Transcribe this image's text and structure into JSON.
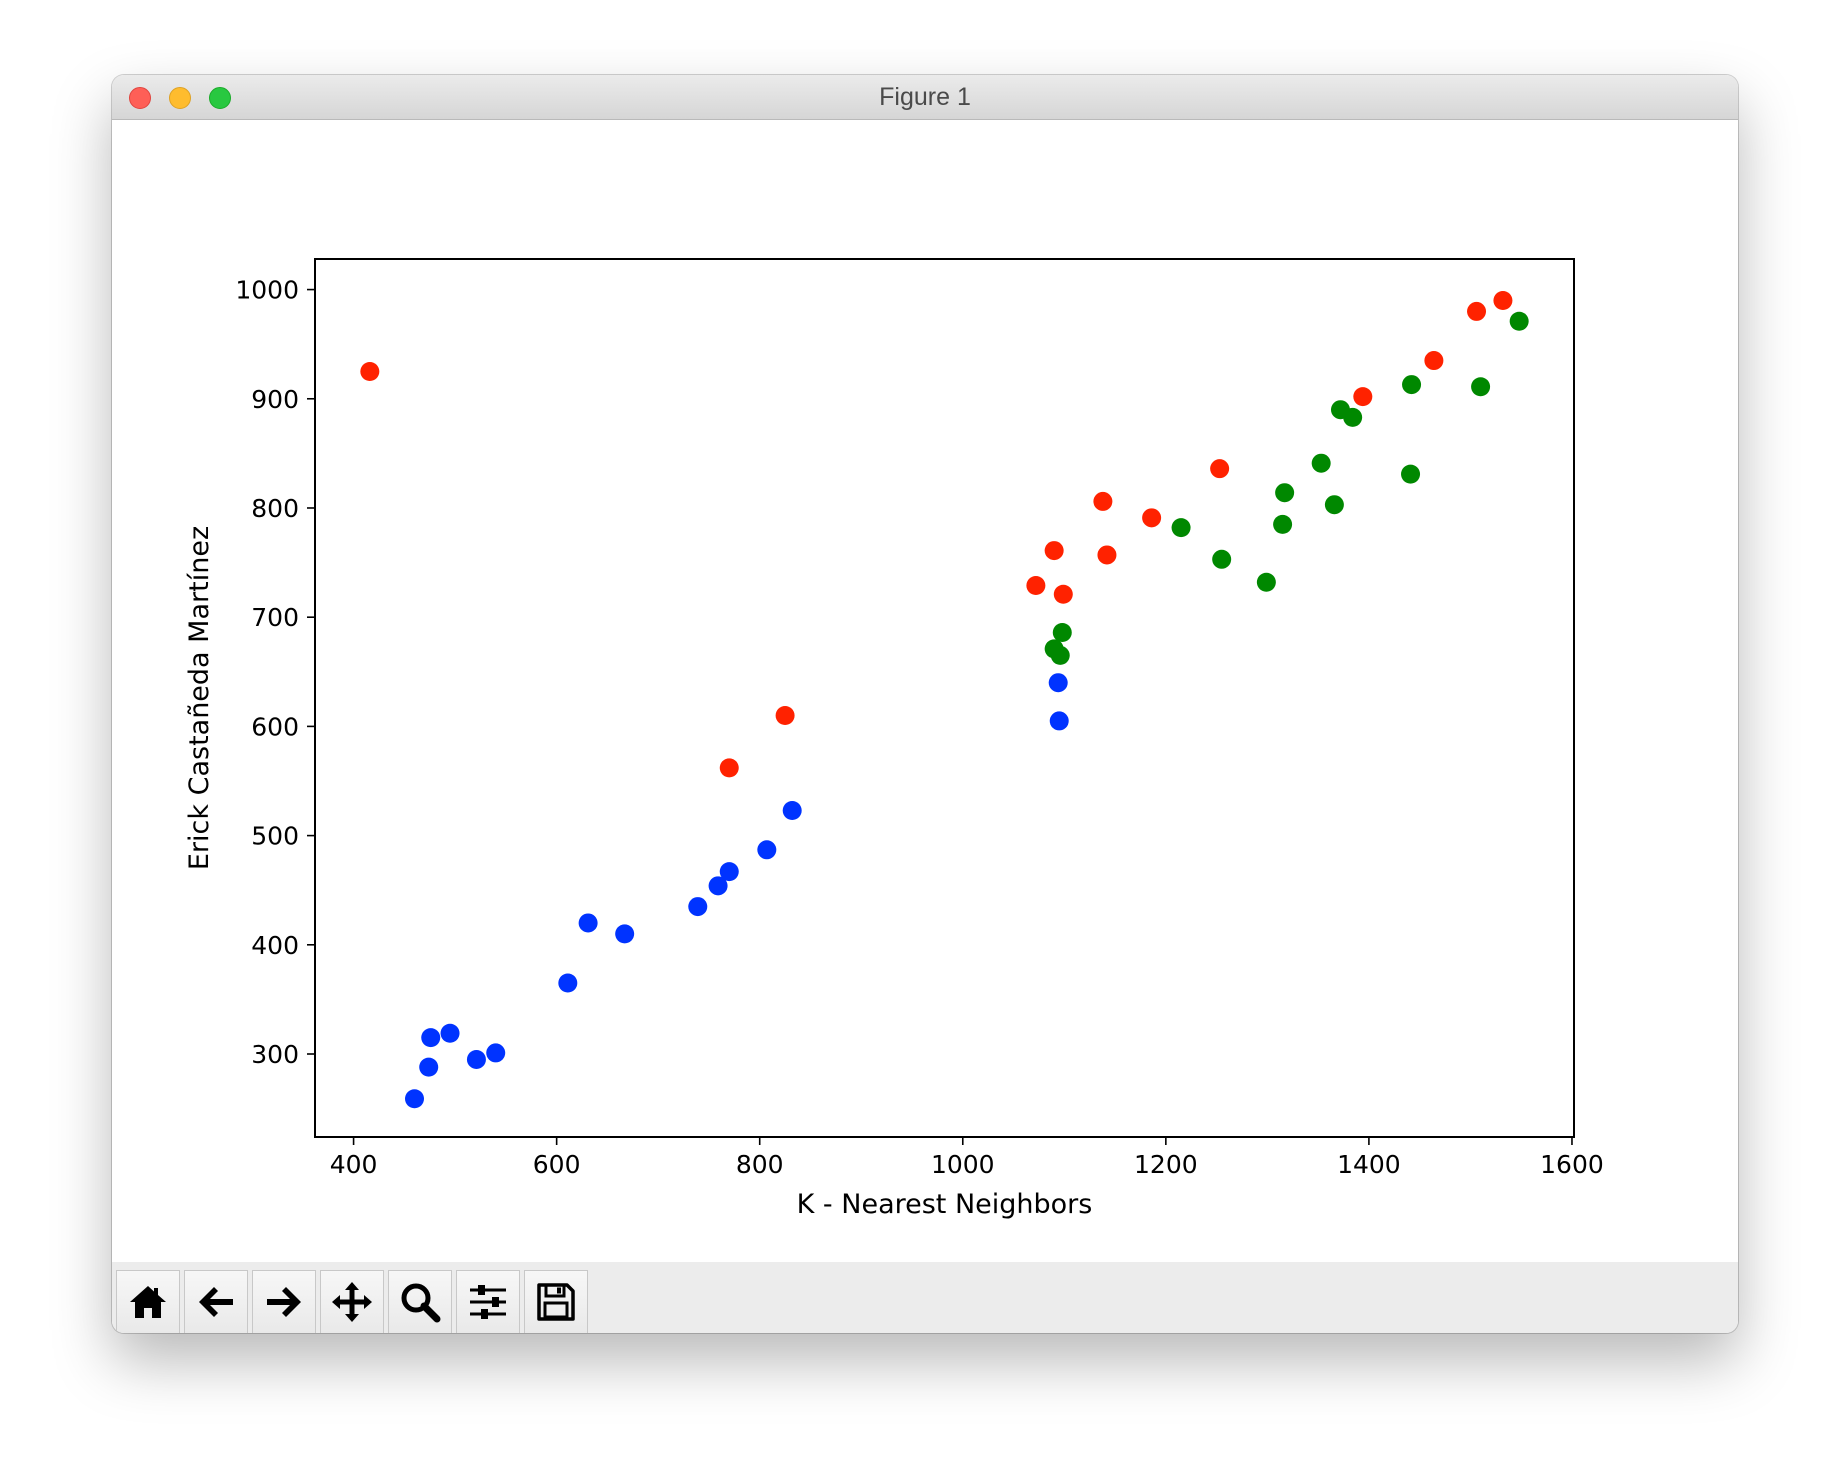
{
  "window": {
    "title": "Figure 1"
  },
  "toolbar": {
    "buttons": [
      {
        "name": "home-icon",
        "label": "Home"
      },
      {
        "name": "back-icon",
        "label": "Back"
      },
      {
        "name": "forward-icon",
        "label": "Forward"
      },
      {
        "name": "pan-icon",
        "label": "Pan"
      },
      {
        "name": "zoom-icon",
        "label": "Zoom"
      },
      {
        "name": "configure-subplots-icon",
        "label": "Configure subplots"
      },
      {
        "name": "save-icon",
        "label": "Save"
      }
    ]
  },
  "chart_data": {
    "type": "scatter",
    "title": "",
    "xlabel": "K - Nearest Neighbors",
    "ylabel": "Erick Castañeda Martínez",
    "xlim": [
      362,
      1602
    ],
    "ylim": [
      224,
      1028
    ],
    "xticks": [
      400,
      600,
      800,
      1000,
      1200,
      1400,
      1600
    ],
    "yticks": [
      300,
      400,
      500,
      600,
      700,
      800,
      900,
      1000
    ],
    "grid": false,
    "legend": "none",
    "colors": {
      "blue": "#0033ff",
      "green": "#008800",
      "red": "#ff2200"
    },
    "series": [
      {
        "color": "blue",
        "points": [
          [
            460,
            259
          ],
          [
            474,
            288
          ],
          [
            476,
            315
          ],
          [
            495,
            319
          ],
          [
            521,
            295
          ],
          [
            540,
            301
          ],
          [
            611,
            365
          ],
          [
            631,
            420
          ],
          [
            667,
            410
          ],
          [
            739,
            435
          ],
          [
            759,
            454
          ],
          [
            770,
            467
          ],
          [
            807,
            487
          ],
          [
            832,
            523
          ],
          [
            1094,
            640
          ],
          [
            1095,
            605
          ]
        ]
      },
      {
        "color": "green",
        "points": [
          [
            1090,
            671
          ],
          [
            1096,
            665
          ],
          [
            1098,
            686
          ],
          [
            1215,
            782
          ],
          [
            1255,
            753
          ],
          [
            1299,
            732
          ],
          [
            1315,
            785
          ],
          [
            1317,
            814
          ],
          [
            1353,
            841
          ],
          [
            1366,
            803
          ],
          [
            1372,
            890
          ],
          [
            1384,
            883
          ],
          [
            1441,
            831
          ],
          [
            1442,
            913
          ],
          [
            1510,
            911
          ],
          [
            1548,
            971
          ]
        ]
      },
      {
        "color": "red",
        "points": [
          [
            416,
            925
          ],
          [
            770,
            562
          ],
          [
            825,
            610
          ],
          [
            1072,
            729
          ],
          [
            1090,
            761
          ],
          [
            1099,
            721
          ],
          [
            1138,
            806
          ],
          [
            1142,
            757
          ],
          [
            1186,
            791
          ],
          [
            1253,
            836
          ],
          [
            1394,
            902
          ],
          [
            1464,
            935
          ],
          [
            1506,
            980
          ],
          [
            1532,
            990
          ]
        ]
      }
    ]
  }
}
